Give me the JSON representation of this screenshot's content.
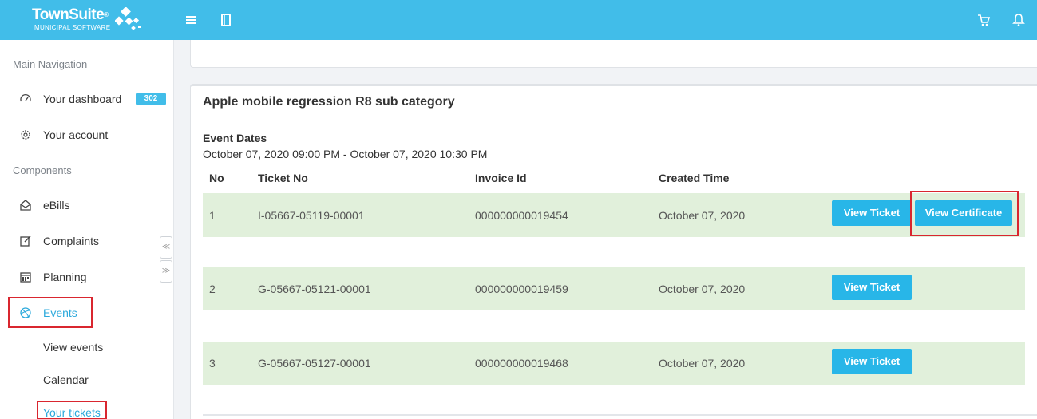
{
  "app": {
    "brand": "TownSuite",
    "brand_mark": "®",
    "brand_sub": "MUNICIPAL SOFTWARE"
  },
  "topbar": {
    "icons": [
      "menu-icon",
      "book-icon",
      "cart-icon",
      "bell-icon"
    ]
  },
  "sidebar": {
    "main_header": "Main Navigation",
    "dashboard_label": "Your dashboard",
    "dashboard_badge": "302",
    "account_label": "Your account",
    "components_header": "Components",
    "ebills_label": "eBills",
    "complaints_label": "Complaints",
    "planning_label": "Planning",
    "events_label": "Events",
    "view_events_label": "View events",
    "calendar_label": "Calendar",
    "your_tickets_label": "Your tickets",
    "scroll_up": "≪",
    "scroll_down": "≫"
  },
  "main": {
    "title": "Apple mobile regression R8 sub category",
    "event_dates_label": "Event Dates",
    "event_dates_value": "October 07, 2020 09:00 PM - October 07, 2020 10:30 PM",
    "columns": {
      "no": "No",
      "ticket_no": "Ticket No",
      "invoice_id": "Invoice Id",
      "created_time": "Created Time"
    },
    "rows": [
      {
        "no": "1",
        "ticket_no": "I-05667-05119-00001",
        "invoice_id": "000000000019454",
        "created_time": "October 07, 2020",
        "view_ticket": "View Ticket",
        "view_certificate": "View Certificate"
      },
      {
        "no": "2",
        "ticket_no": "G-05667-05121-00001",
        "invoice_id": "000000000019459",
        "created_time": "October 07, 2020",
        "view_ticket": "View Ticket"
      },
      {
        "no": "3",
        "ticket_no": "G-05667-05127-00001",
        "invoice_id": "000000000019468",
        "created_time": "October 07, 2020",
        "view_ticket": "View Ticket"
      }
    ]
  },
  "colors": {
    "topbar": "#41bde9",
    "button": "#28b6e8",
    "row_bg": "#e1f0db",
    "active_nav": "#2ba9dc",
    "highlight_box": "#d9262f"
  }
}
